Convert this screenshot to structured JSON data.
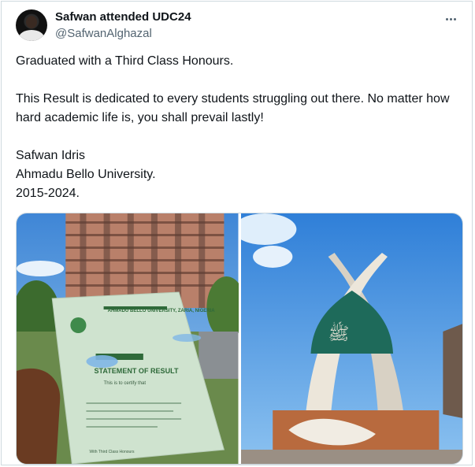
{
  "tweet": {
    "display_name": "Safwan attended UDC24",
    "handle": "@SafwanAlghazal",
    "lines": [
      "Graduated with a Third Class Honours.",
      "This Result is dedicated to every students struggling out there. No matter how hard academic life is, you shall prevail lastly!",
      "Safwan Idris",
      "Ahmadu Bello University.",
      "2015-2024."
    ]
  },
  "media": {
    "left_photo": {
      "doc_header": "AHMADU BELLO UNIVERSITY, ZARIA, NIGERIA",
      "doc_title": "STATEMENT OF RESULT",
      "doc_line": "This is to certify that",
      "doc_class": "With Third Class Honours"
    }
  },
  "icons": {
    "more": "more-horizontal-icon"
  },
  "colors": {
    "text": "#0f1419",
    "secondary": "#536471",
    "border": "#cfd9de",
    "sky": "#5aa0e0",
    "building": "#b9806a",
    "paper": "#cfe3cf"
  }
}
